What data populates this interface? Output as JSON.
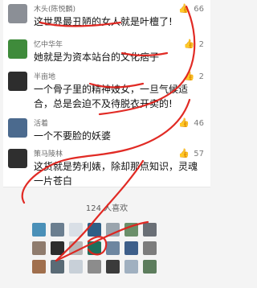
{
  "comments": [
    {
      "author": "木头(陈悦麟)",
      "likes": "66",
      "text": "这世界最丑陋的女人就是叶檀了!",
      "avatar_color": "#8b8f96"
    },
    {
      "author": "忆中华年",
      "likes": "2",
      "text": "她就是为资本站台的文化痞子",
      "avatar_color": "#3f8b3b"
    },
    {
      "author": "半亩地",
      "likes": "2",
      "text": "一个骨子里的精神妓女，一旦气候适合，总是会迫不及待脱衣开卖的!",
      "avatar_color": "#2d2d2d"
    },
    {
      "author": "活着",
      "likes": "46",
      "text": "一个不要脸的妖婆",
      "avatar_color": "#4b6a8e"
    },
    {
      "author": "策马陵林",
      "likes": "57",
      "text": "这货就是势利婊，除却那点知识，灵魂一片苍白",
      "avatar_color": "#2f2f2f"
    }
  ],
  "likes_summary": "124 人喜欢",
  "ui_icons": {
    "thumb_up": "thumb-up-icon"
  },
  "colors": {
    "scribble_red": "#e0201a"
  }
}
